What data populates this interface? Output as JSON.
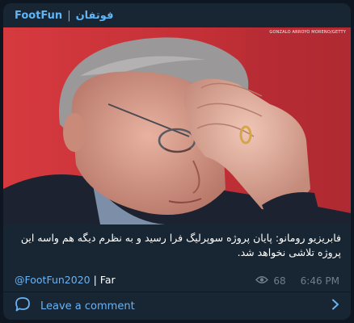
{
  "header": {
    "title_en": "FootFun",
    "separator": "|",
    "title_fa": "فوتفان"
  },
  "photo": {
    "credit": "GONZALO ARROYO MORENO/GETTY",
    "background_color": "#c8323a"
  },
  "message": {
    "text": "فابریزیو رومانو: پایان پروژه سوپرلیگ فرا رسید و به نظرم دیگه هم واسه این پروژه تلاشی نخواهد شد."
  },
  "signature": {
    "handle": "@FootFun2020",
    "separator": "|",
    "lang": "Far"
  },
  "meta": {
    "views": "68",
    "time": "6:46 PM"
  },
  "comment": {
    "label": "Leave a comment",
    "icon": "comment-bubble-icon",
    "arrow_icon": "chevron-right-icon"
  },
  "colors": {
    "background": "#0e1621",
    "card": "#182533",
    "accent": "#6ab3f3"
  }
}
